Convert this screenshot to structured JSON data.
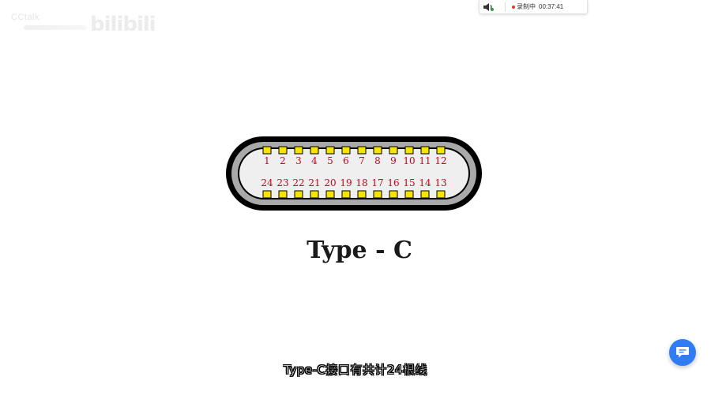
{
  "watermark": {
    "small_text": "CCtalk",
    "logo_text": "bilibili"
  },
  "recorder": {
    "speaker_icon": "speaker-icon",
    "status": "录制中",
    "time": "00:37:41",
    "dot_color": "#e53935"
  },
  "connector": {
    "top_pins": [
      "1",
      "2",
      "3",
      "4",
      "5",
      "6",
      "7",
      "8",
      "9",
      "10",
      "11",
      "12"
    ],
    "bottom_pins": [
      "24",
      "23",
      "22",
      "21",
      "20",
      "19",
      "18",
      "17",
      "16",
      "15",
      "14",
      "13"
    ],
    "pin_color": "#f5e400",
    "label_color": "#d0021b"
  },
  "title": "Type - C",
  "subtitle": "Type-C接口有共计24根线",
  "chat_button": {
    "icon": "chat-bubble-icon",
    "color": "#2f7cf6"
  }
}
